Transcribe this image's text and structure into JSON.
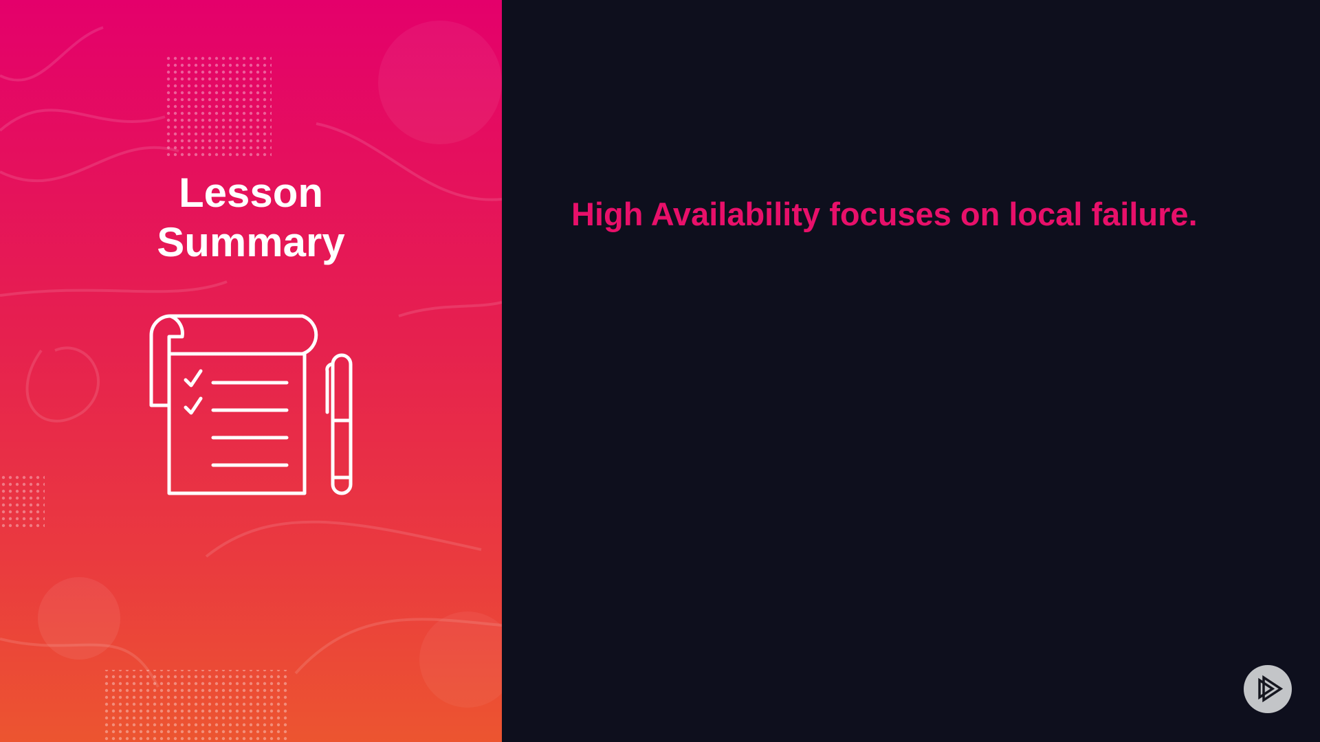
{
  "slide": {
    "panel_title_line1": "Lesson",
    "panel_title_line2": "Summary",
    "main_text": "High Availability focuses on local failure.",
    "icon": "checklist-with-pen-icon",
    "logo_icon": "play-logo-icon"
  },
  "colors": {
    "accent": "#e8106a",
    "background": "#0e0f1d",
    "gradient_top": "#e4006b",
    "gradient_bottom": "#ec5530"
  }
}
